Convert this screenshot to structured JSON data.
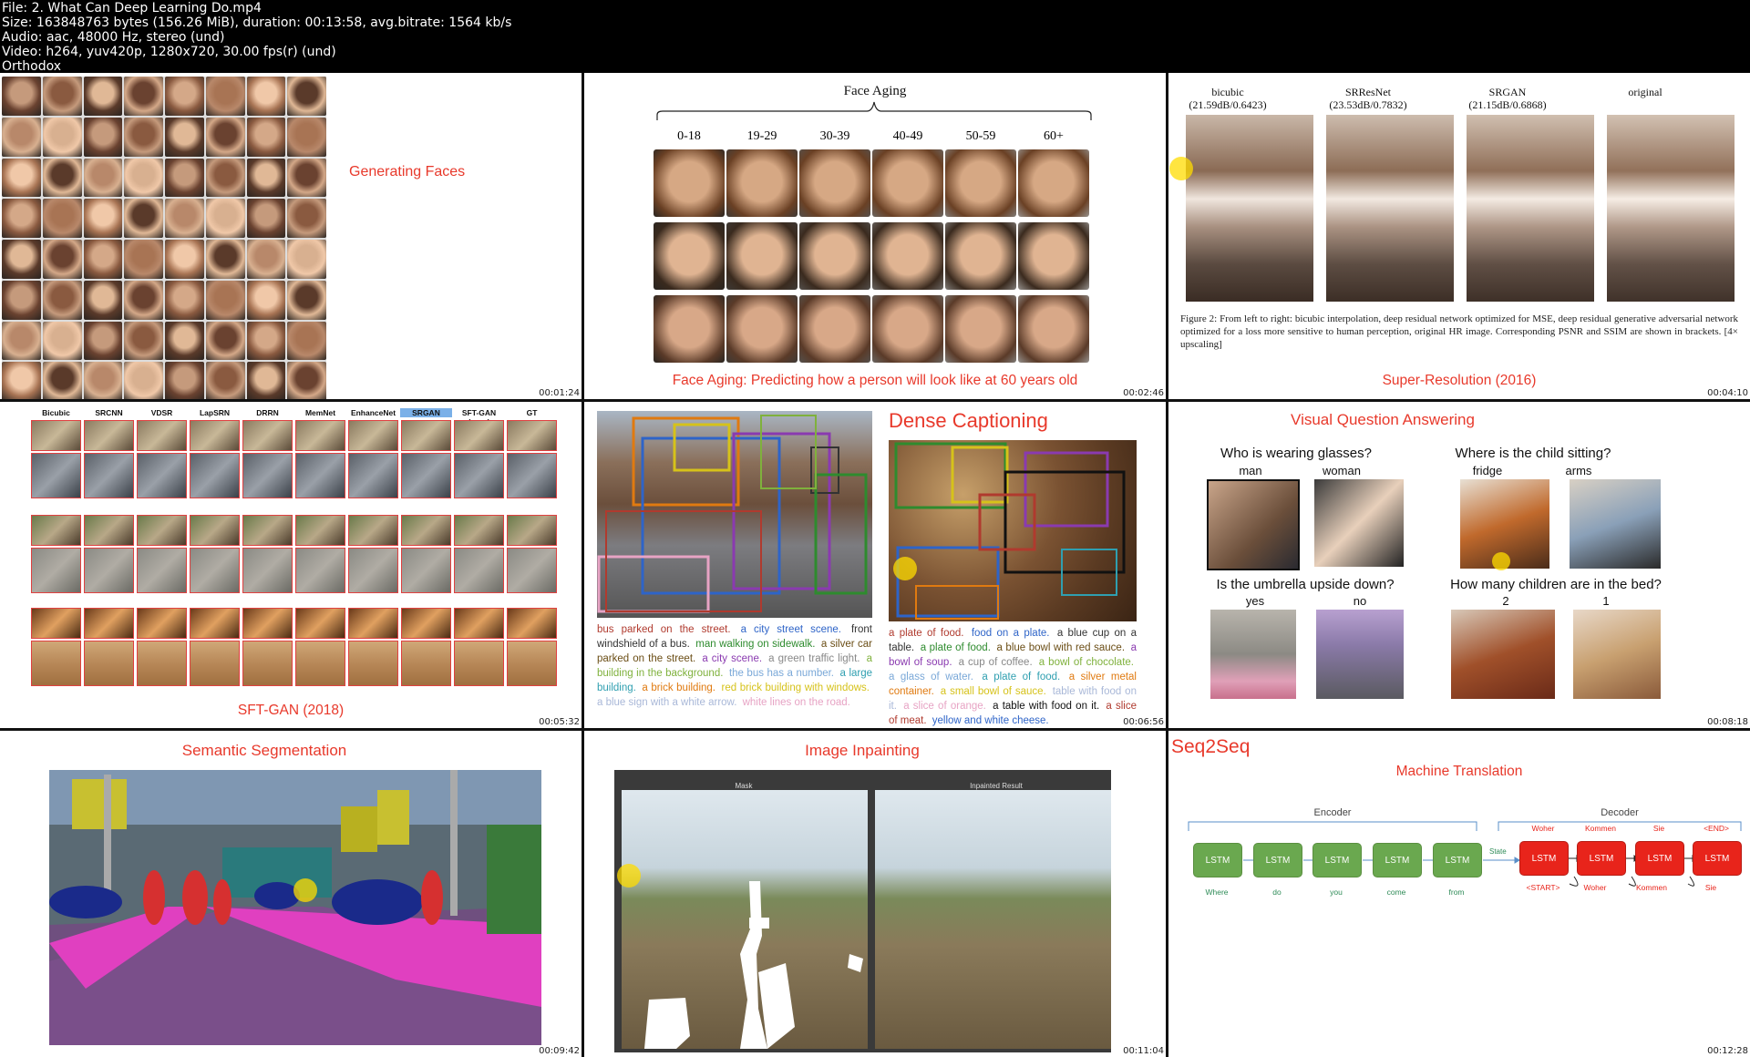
{
  "header": {
    "lines": [
      "File: 2. What Can Deep Learning Do.mp4",
      "Size: 163848763 bytes (156.26 MiB), duration: 00:13:58, avg.bitrate: 1564 kb/s",
      "Audio: aac, 48000 Hz, stereo (und)",
      "Video: h264, yuv420p, 1280x720, 30.00 fps(r) (und)",
      "Orthodox"
    ]
  },
  "tiles": {
    "faces": {
      "title": "Generating Faces",
      "timestamp": "00:01:24"
    },
    "aging": {
      "heading": "Face Aging",
      "ages": [
        "0-18",
        "19-29",
        "30-39",
        "40-49",
        "50-59",
        "60+"
      ],
      "title": "Face Aging: Predicting how a person will look like at 60 years old",
      "timestamp": "00:02:46"
    },
    "superres": {
      "columns": [
        {
          "name": "bicubic",
          "score": "(21.59dB/0.6423)"
        },
        {
          "name": "SRResNet",
          "score": "(23.53dB/0.7832)"
        },
        {
          "name": "SRGAN",
          "score": "(21.15dB/0.6868)"
        },
        {
          "name": "original",
          "score": ""
        }
      ],
      "caption": "Figure 2: From left to right: bicubic interpolation, deep residual network optimized for MSE, deep residual generative adversarial network optimized for a loss more sensitive to human perception, original HR image. Corresponding PSNR and SSIM are shown in brackets. [4× upscaling]",
      "title": "Super-Resolution (2016)",
      "timestamp": "00:04:10"
    },
    "sftgan": {
      "columns": [
        "Bicubic",
        "SRCNN",
        "VDSR",
        "LapSRN",
        "DRRN",
        "MemNet",
        "EnhanceNet",
        "SRGAN",
        "SFT-GAN (ours)",
        "GT"
      ],
      "title": "SFT-GAN (2018)",
      "timestamp": "00:05:32"
    },
    "dense": {
      "title": "Dense Captioning",
      "left_caption": [
        {
          "t": "bus parked on the street.",
          "c": "#b03a2e"
        },
        {
          "t": "a city street scene.",
          "c": "#2e64c8"
        },
        {
          "t": "front windshield of a bus.",
          "c": "#333333"
        },
        {
          "t": "man walking on sidewalk.",
          "c": "#2e8b2e"
        },
        {
          "t": "a silver car parked on the street.",
          "c": "#6b4e16"
        },
        {
          "t": "a city scene.",
          "c": "#8a3ab0"
        },
        {
          "t": "a green traffic light.",
          "c": "#888888"
        },
        {
          "t": "a building in the background.",
          "c": "#7fb13c"
        },
        {
          "t": "the bus has a number.",
          "c": "#7aa8d8"
        },
        {
          "t": "a large building.",
          "c": "#2f9fb0"
        },
        {
          "t": "a brick building.",
          "c": "#e07a10"
        },
        {
          "t": "red brick building with windows.",
          "c": "#d6c21a"
        },
        {
          "t": "a blue sign with a white arrow.",
          "c": "#a9b8d8"
        },
        {
          "t": "white lines on the road.",
          "c": "#e7a3c4"
        }
      ],
      "right_caption": [
        {
          "t": "a plate of food.",
          "c": "#b03a2e"
        },
        {
          "t": "food on a plate.",
          "c": "#2e64c8"
        },
        {
          "t": "a blue cup on a table.",
          "c": "#333333"
        },
        {
          "t": "a plate of food.",
          "c": "#2e8b2e"
        },
        {
          "t": "a blue bowl with red sauce.",
          "c": "#6b4e16"
        },
        {
          "t": "a bowl of soup.",
          "c": "#8a3ab0"
        },
        {
          "t": "a cup of coffee.",
          "c": "#888888"
        },
        {
          "t": "a bowl of chocolate.",
          "c": "#7fb13c"
        },
        {
          "t": "a glass of water.",
          "c": "#7aa8d8"
        },
        {
          "t": "a plate of food.",
          "c": "#2f9fb0"
        },
        {
          "t": "a silver metal container.",
          "c": "#e07a10"
        },
        {
          "t": "a small bowl of sauce.",
          "c": "#d6c21a"
        },
        {
          "t": "table with food on it.",
          "c": "#a9b8d8"
        },
        {
          "t": "a slice of orange.",
          "c": "#e7a3c4"
        },
        {
          "t": "a table with food on it.",
          "c": "#111111"
        },
        {
          "t": "a slice of meat.",
          "c": "#b03a2e"
        },
        {
          "t": "yellow and white cheese.",
          "c": "#2e64c8"
        }
      ],
      "timestamp": "00:06:56"
    },
    "vqa": {
      "title": "Visual Question Answering",
      "questions": [
        {
          "q": "Who is wearing glasses?",
          "a": [
            "man",
            "woman"
          ]
        },
        {
          "q": "Where is the child sitting?",
          "a": [
            "fridge",
            "arms"
          ]
        },
        {
          "q": "Is the umbrella upside down?",
          "a": [
            "yes",
            "no"
          ]
        },
        {
          "q": "How many children are in the bed?",
          "a": [
            "2",
            "1"
          ]
        }
      ],
      "timestamp": "00:08:18"
    },
    "segmentation": {
      "title": "Semantic Segmentation",
      "timestamp": "00:09:42"
    },
    "inpainting": {
      "title": "Image Inpainting",
      "panel_left": "Mask",
      "panel_right": "Inpainted Result",
      "timestamp": "00:11:04"
    },
    "seq2seq": {
      "heading": "Seq2Seq",
      "title": "Machine Translation",
      "encoder_label": "Encoder",
      "decoder_label": "Decoder",
      "cell_label": "LSTM",
      "state_label": "State",
      "inputs": [
        "Where",
        "do",
        "you",
        "come",
        "from"
      ],
      "outputs_top": [
        "Woher",
        "Kommen",
        "Sie",
        "<END>"
      ],
      "outputs_bottom": [
        "<START>",
        "Woher",
        "Kommen",
        "Sie"
      ],
      "timestamp": "00:12:28"
    }
  }
}
